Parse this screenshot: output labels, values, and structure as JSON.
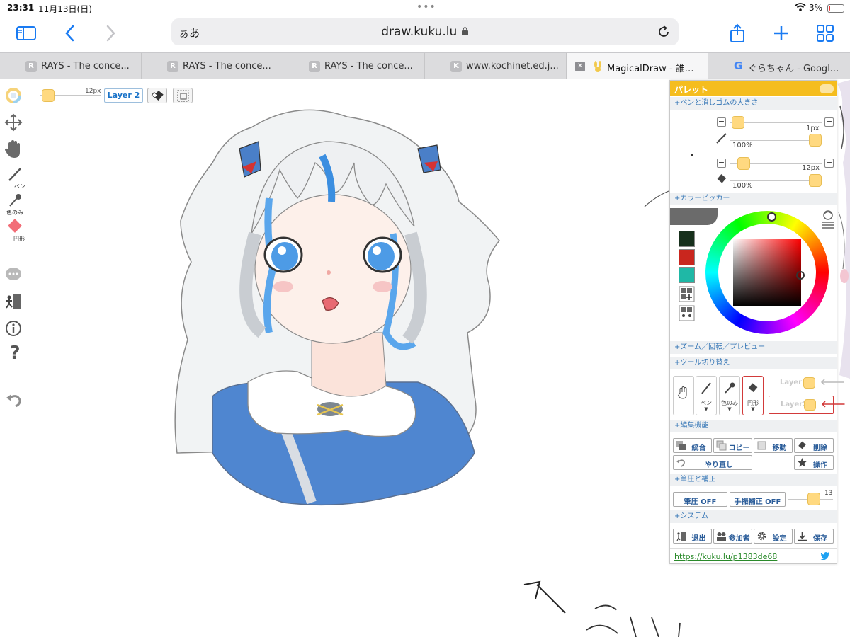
{
  "status": {
    "time": "23:31",
    "date": "11月13日(日)",
    "battery": "3%",
    "battery_level": 0.03
  },
  "toolbar": {
    "aa_label": "ぁあ",
    "url": "draw.kuku.lu"
  },
  "tabs": [
    {
      "favicon": "R",
      "title": "RAYS - The conce..."
    },
    {
      "favicon": "R",
      "title": "RAYS - The conce..."
    },
    {
      "favicon": "R",
      "title": "RAYS - The conce..."
    },
    {
      "favicon": "K",
      "title": "www.kochinet.ed.j..."
    },
    {
      "favicon": "",
      "title": "MagicalDraw - 誰…"
    },
    {
      "favicon": "G",
      "title": "ぐらちゃん - Googl..."
    }
  ],
  "left_tools": {
    "pen": "ペン",
    "picker": "色のみ",
    "shape": "円形"
  },
  "top_bar": {
    "size": "12px",
    "size_level": 0.05,
    "layer": "Layer 2"
  },
  "palette": {
    "title": "パレット",
    "sections": {
      "pen_eraser": "+ペンと消しゴムの大きさ",
      "color_picker": "+カラーピッカー",
      "zoom": "+ズーム／回転／プレビュー",
      "tool_switch": "+ツール切り替え",
      "edit": "+編集機能",
      "pressure": "+筆圧と補正",
      "system": "+システム"
    },
    "pen": {
      "size": "1px",
      "opacity": "100%",
      "size_level": 0.03,
      "opacity_level": 1.0
    },
    "eraser": {
      "size": "12px",
      "opacity": "100%",
      "size_level": 0.1,
      "opacity_level": 1.0
    },
    "swatches": [
      "#17301c",
      "#c9261e",
      "#1fb8a6"
    ],
    "tools": {
      "pen": "ペン",
      "picker": "色のみ",
      "shape": "円形"
    },
    "layers": [
      "Layer1",
      "Layer2"
    ],
    "edit_buttons": {
      "merge": "統合",
      "copy": "コピー",
      "move": "移動",
      "delete": "削除",
      "redo": "やり直し",
      "operate": "操作"
    },
    "pressure": {
      "pressure_btn": "筆圧 OFF",
      "stabilizer_btn": "手振補正 OFF",
      "value": "13",
      "level": 0.6
    },
    "system_buttons": {
      "exit": "退出",
      "participants": "参加者",
      "settings": "設定",
      "save": "保存"
    },
    "link": "https://kuku.lu/p1383de68"
  }
}
